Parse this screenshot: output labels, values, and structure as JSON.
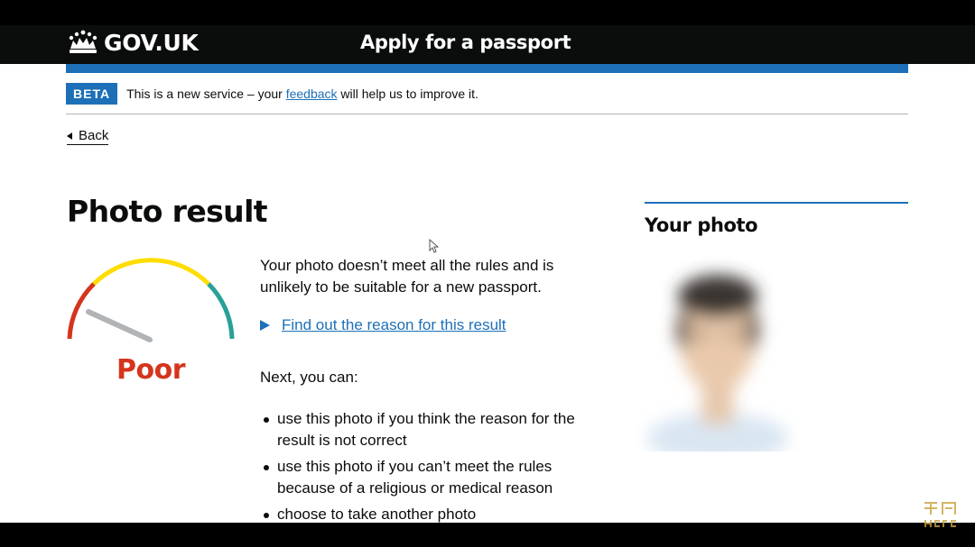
{
  "header": {
    "logo_text": "GOV.UK",
    "service_name": "Apply for a passport"
  },
  "phase_banner": {
    "tag": "BETA",
    "text_before": "This is a new service – your",
    "link_text": "feedback",
    "text_after": "will help us to improve it."
  },
  "back_link": "Back",
  "main": {
    "title": "Photo result",
    "rating": "Poor",
    "rating_color": "#d4351c",
    "result_text": "Your photo doesn’t meet all the rules and is unlikely to be suitable for a new passport.",
    "details_summary": "Find out the reason for this result",
    "next_intro": "Next, you can:",
    "options": [
      "use this photo if you think the reason for the result is not correct",
      "use this photo if you can’t meet the rules because of a religious or medical reason",
      "choose to take another photo"
    ]
  },
  "photo_panel": {
    "heading": "Your photo"
  },
  "colors": {
    "brand_blue": "#1d70b8",
    "header_black": "#0b0c0c",
    "gauge_red": "#d4351c",
    "gauge_yellow": "#ffdd00",
    "gauge_teal": "#28a197"
  },
  "icons": {
    "logo": "crown-icon",
    "back": "triangle-left-icon",
    "details": "triangle-right-icon"
  }
}
